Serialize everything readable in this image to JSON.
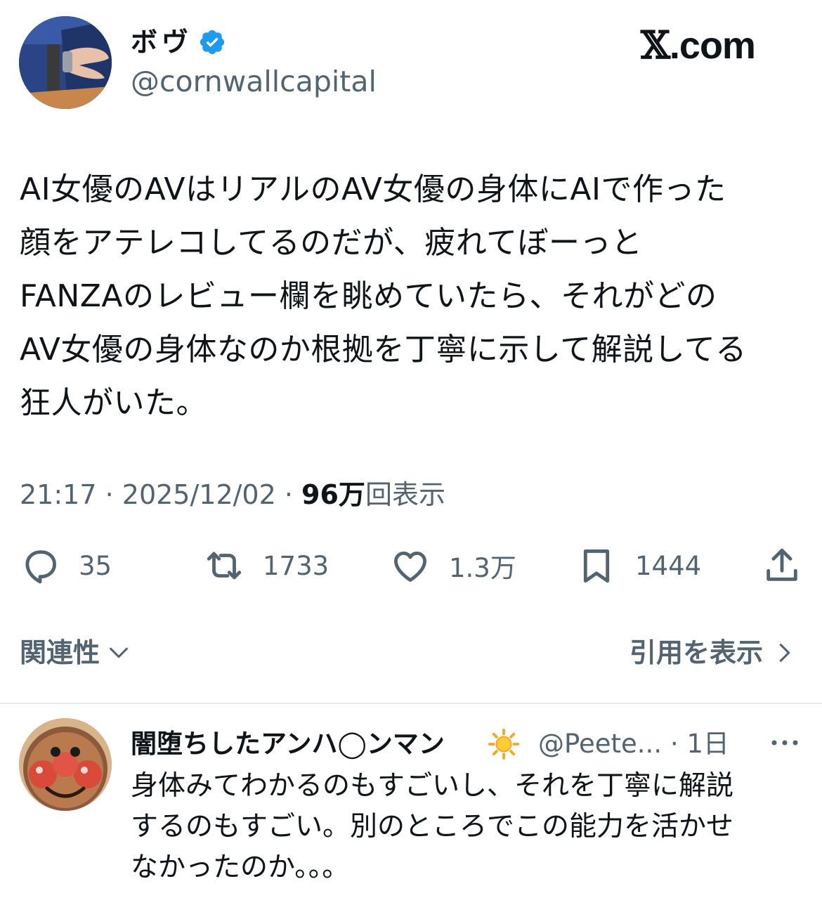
{
  "tweet": {
    "display_name": "ボヴ",
    "handle": "@cornwallcapital",
    "brand": {
      "x": "𝕏",
      "rest": ".com"
    },
    "text": "AI女優のAVはリアルのAV女優の身体にAIで作った\n顔をアテレコしてるのだが、疲れてぼーっと\nFANZAのレビュー欄を眺めていたら、それがどの\nAV女優の身体なのか根拠を丁寧に示して解説してる\n狂人がいた。",
    "time": "21:17",
    "date": "2025/12/02",
    "views_count": "96万",
    "views_label": "回表示",
    "separator": " · "
  },
  "actions": {
    "replies": "35",
    "reposts": "1733",
    "likes": "1.3万",
    "bookmarks": "1444"
  },
  "filters": {
    "relevance_label": "関連性",
    "quotes_label": "引用を表示"
  },
  "reply": {
    "display_name": "闇堕ちしたアンハ◯ンマン",
    "handle": "@Peete...",
    "time": "1日",
    "text": "身体みてわかるのもすごいし、それを丁寧に解説\nするのもすごい。別のところでこの能力を活かせ\nなかったのか。。。"
  },
  "colors": {
    "text": "#0f1419",
    "secondary": "#536471",
    "verified": "#1d9bf0",
    "divider": "#e6e9eb"
  },
  "icons": {
    "verified": "verified-badge-icon",
    "reply": "speech-bubble-icon",
    "repost": "repost-arrows-icon",
    "like": "heart-icon",
    "bookmark": "bookmark-icon",
    "share": "share-upload-icon",
    "relevance": "chevron-down-icon",
    "quotes": "chevron-right-icon",
    "emoji": "sun-emoji-icon",
    "more": "more-dots-icon"
  }
}
